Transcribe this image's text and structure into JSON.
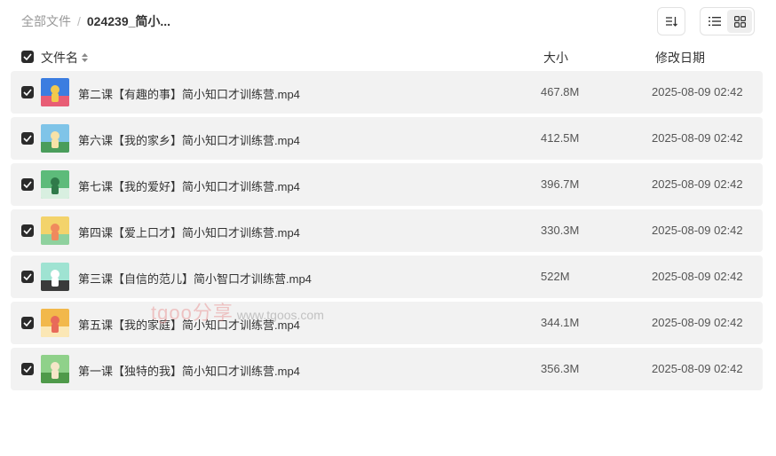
{
  "breadcrumb": {
    "root": "全部文件",
    "separator": "/",
    "current": "024239_简小..."
  },
  "toolbar": {
    "sort_icon": "sort-descending-icon",
    "list_icon": "list-view-icon",
    "grid_icon": "grid-view-icon",
    "active_view": "list"
  },
  "table": {
    "headers": {
      "name": "文件名",
      "size": "大小",
      "date": "修改日期"
    },
    "rows": [
      {
        "name": "第二课【有趣的事】简小知口才训练营.mp4",
        "size": "467.8M",
        "date": "2025-08-09 02:42",
        "thumb": [
          "#3b7de0",
          "#f2c94c",
          "#e85d75"
        ]
      },
      {
        "name": "第六课【我的家乡】简小知口才训练营.mp4",
        "size": "412.5M",
        "date": "2025-08-09 02:42",
        "thumb": [
          "#7fc4e8",
          "#f6e2a8",
          "#4a9d5b"
        ]
      },
      {
        "name": "第七课【我的爱好】简小知口才训练营.mp4",
        "size": "396.7M",
        "date": "2025-08-09 02:42",
        "thumb": [
          "#5dbb7a",
          "#2f7a4a",
          "#d8efe0"
        ]
      },
      {
        "name": "第四课【爱上口才】简小知口才训练营.mp4",
        "size": "330.3M",
        "date": "2025-08-09 02:42",
        "thumb": [
          "#f3d36b",
          "#f08a5d",
          "#8fd19e"
        ]
      },
      {
        "name": "第三课【自信的范儿】简小智口才训练营.mp4",
        "size": "522M",
        "date": "2025-08-09 02:42",
        "thumb": [
          "#9fe3d2",
          "#ffffff",
          "#3a3a3a"
        ]
      },
      {
        "name": "第五课【我的家庭】简小知口才训练营.mp4",
        "size": "344.1M",
        "date": "2025-08-09 02:42",
        "thumb": [
          "#f2b84b",
          "#e86a5a",
          "#fbe7b5"
        ]
      },
      {
        "name": "第一课【独特的我】简小知口才训练营.mp4",
        "size": "356.3M",
        "date": "2025-08-09 02:42",
        "thumb": [
          "#8fd18a",
          "#f5e6c8",
          "#4f9a4a"
        ]
      }
    ]
  },
  "watermark": {
    "brand": "tgoo分享",
    "url": "www.tgoos.com"
  },
  "colors": {
    "row_bg": "#f2f2f2",
    "checkbox": "#2b2b2b",
    "muted_text": "#999999"
  }
}
